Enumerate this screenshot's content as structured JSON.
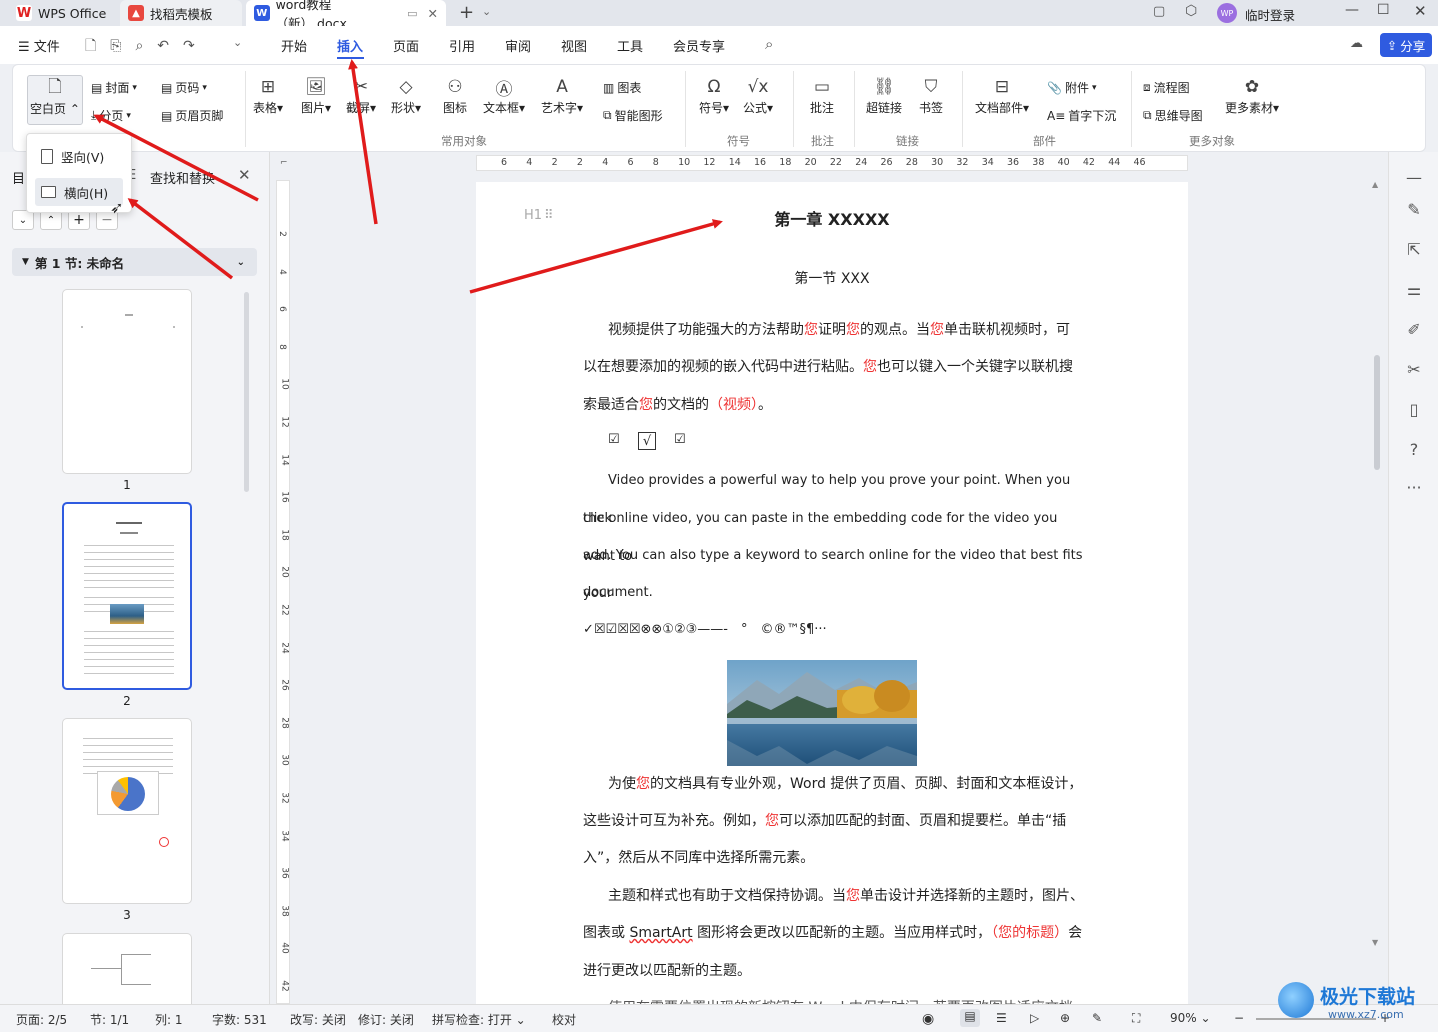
{
  "tabs": [
    {
      "label": "WPS Office",
      "icon": "wps-logo-icon"
    },
    {
      "label": "找稻壳模板",
      "icon": "daoke-icon"
    },
    {
      "label": "word教程（新）.docx",
      "icon": "word-doc-icon"
    }
  ],
  "titlebar": {
    "user": "临时登录",
    "new_tab": "+"
  },
  "menu": {
    "file": "文件",
    "items": [
      "开始",
      "插入",
      "页面",
      "引用",
      "审阅",
      "视图",
      "工具",
      "会员专享"
    ],
    "selected": "插入",
    "share": "分享"
  },
  "ribbon": {
    "blank_page": "空白页",
    "cover": "封面",
    "page_num": "页码",
    "page_break": "分页",
    "header_footer": "页眉页脚",
    "table": "表格",
    "picture": "图片",
    "screenshot": "截屏",
    "shape": "形状",
    "icon": "图标",
    "textbox": "文本框",
    "wordart": "艺术字",
    "chart": "图表",
    "smart_shape": "智能图形",
    "symbol": "符号",
    "formula": "公式",
    "comment": "批注",
    "hyperlink": "超链接",
    "bookmark": "书签",
    "doc_parts": "文档部件",
    "attachment": "附件",
    "drop_cap": "首字下沉",
    "flowchart": "流程图",
    "mindmap": "思维导图",
    "more_material": "更多素材",
    "groups": [
      "常用对象",
      "符号",
      "批注",
      "链接",
      "部件",
      "更多对象"
    ]
  },
  "dropdown": {
    "portrait": "竖向(V)",
    "landscape": "横向(H)"
  },
  "left_panel": {
    "tab_outline": "目",
    "tab_find": "查找和替换",
    "section": "第 1 节: 未命名",
    "pages": [
      "1",
      "2",
      "3"
    ]
  },
  "ruler": {
    "h_ticks": [
      "6",
      "4",
      "2",
      "2",
      "4",
      "6",
      "8",
      "10",
      "12",
      "14",
      "16",
      "18",
      "20",
      "22",
      "24",
      "26",
      "28",
      "30",
      "32",
      "34",
      "36",
      "38",
      "40",
      "42",
      "44",
      "46"
    ],
    "v_ticks": [
      "2",
      "4",
      "6",
      "8",
      "10",
      "12",
      "14",
      "16",
      "18",
      "20",
      "22",
      "24",
      "26",
      "28",
      "30",
      "32",
      "34",
      "36",
      "38",
      "40",
      "42"
    ]
  },
  "document": {
    "heading_marker": "H1",
    "chapter": "第一章 XXXXX",
    "section": "第一节 XXX",
    "p1": [
      "视频提供了功能强大的方法帮助",
      "您",
      "证明",
      "您",
      "的观点。当",
      "您",
      "单击联机视频时，可"
    ],
    "p1_l2": [
      "以在想要添加的视频的嵌入代码中进行粘贴。",
      "您",
      "也可以键入一个关键字以联机搜"
    ],
    "p1_l3": [
      "索最适合",
      "您",
      "的文档的",
      "（视频）",
      "。"
    ],
    "checkboxes": [
      "☑",
      "√",
      "☑"
    ],
    "en_lines": [
      "Video provides a powerful way to help you prove your point. When you click",
      "the online video, you can paste in the embedding code for the video you want to",
      "add. You can also type a keyword to search online for the video that best fits your",
      "document."
    ],
    "symbols": "✓☒☑☒☒⊗⊗①②③——-　°　©®™§¶···",
    "p2": [
      [
        "为使",
        "您",
        "的文档具有专业外观，Word 提供了页眉、页脚、封面和文本框设计，"
      ],
      [
        "这些设计可互为补充。例如，",
        "您",
        "可以添加匹配的封面、页眉和提要栏。单击“插"
      ],
      [
        "入”，然后从不同库中选择所需元素。",
        "",
        ""
      ]
    ],
    "p3": [
      [
        "主题和样式也有助于文档保持协调。当",
        "您",
        "单击设计并选择新的主题时，图片、"
      ],
      [
        "图表或 ",
        "SmartArt",
        " 图形将会更改以匹配新的主题。当应用样式时，",
        "（您的标题）",
        "会"
      ],
      [
        "进行更改以匹配新的主题。"
      ]
    ],
    "p4_partial": "使用在需要位置出现的新按钮在 Word 中保存时间。若要更改图片适应文档"
  },
  "status": {
    "page": "页面: 2/5",
    "section": "节: 1/1",
    "column": "列: 1",
    "words": "字数: 531",
    "overtype": "改写: 关闭",
    "revision": "修订: 关闭",
    "spell": "拼写检查: 打开",
    "proof": "校对",
    "zoom": "90%"
  },
  "watermark": {
    "brand": "极光下载站",
    "url": "www.xz7.com"
  },
  "colors": {
    "accent": "#2f5be0",
    "arrow": "#e01b1b",
    "red_text": "#e33333"
  }
}
